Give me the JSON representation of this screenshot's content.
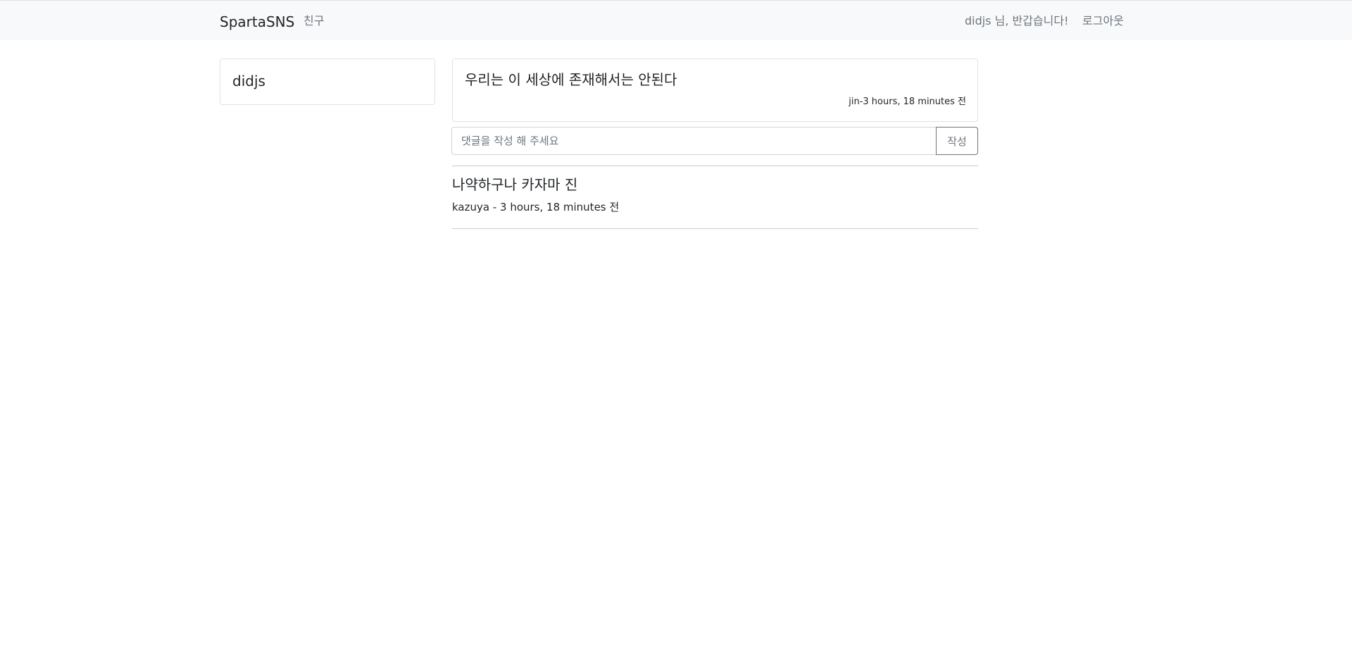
{
  "navbar": {
    "brand": "SpartaSNS",
    "friends_link": "친구",
    "greeting": "didjs 님, 반갑습니다!",
    "logout_link": "로그아웃"
  },
  "profile": {
    "username": "didjs"
  },
  "post": {
    "content": "우리는 이 세상에 존재해서는 안된다",
    "meta": "jin-3 hours, 18 minutes 전"
  },
  "comment_form": {
    "placeholder": "댓글을 작성 해 주세요",
    "value": "",
    "submit_label": "작성"
  },
  "comments": [
    {
      "text": "나약하구나 카자마 진",
      "meta": "kazuya - 3 hours, 18 minutes 전"
    }
  ]
}
